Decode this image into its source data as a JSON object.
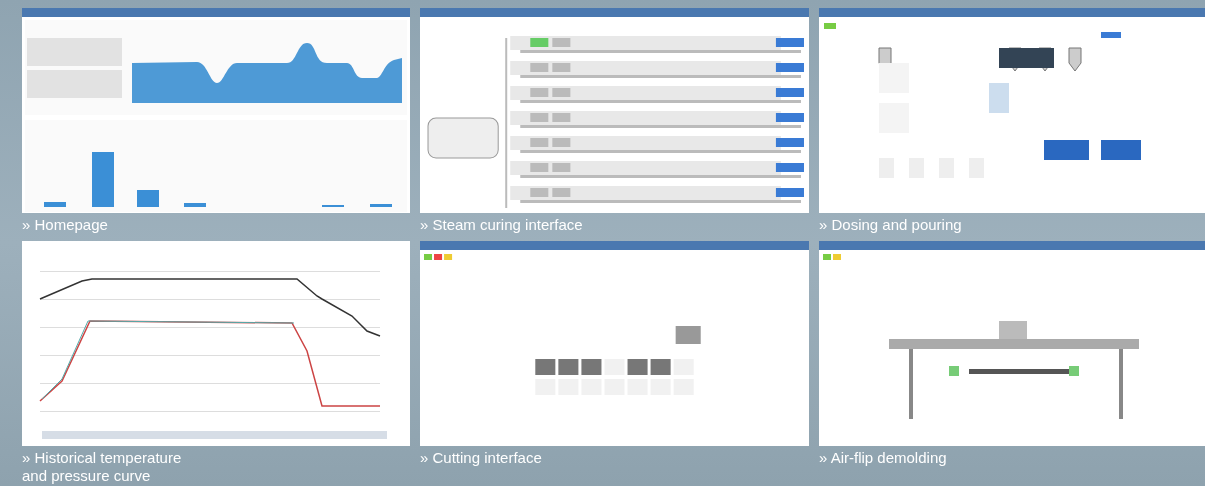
{
  "panels": [
    {
      "kind": "dashboard",
      "caption": "» Homepage"
    },
    {
      "kind": "steam",
      "caption": "» Steam curing interface"
    },
    {
      "kind": "dosing",
      "caption": "» Dosing and pouring"
    },
    {
      "kind": "curve",
      "caption": "» Historical temperature and pressure curve"
    },
    {
      "kind": "cutting",
      "caption": "» Cutting interface"
    },
    {
      "kind": "demolding",
      "caption": "» Air-flip demolding"
    }
  ]
}
